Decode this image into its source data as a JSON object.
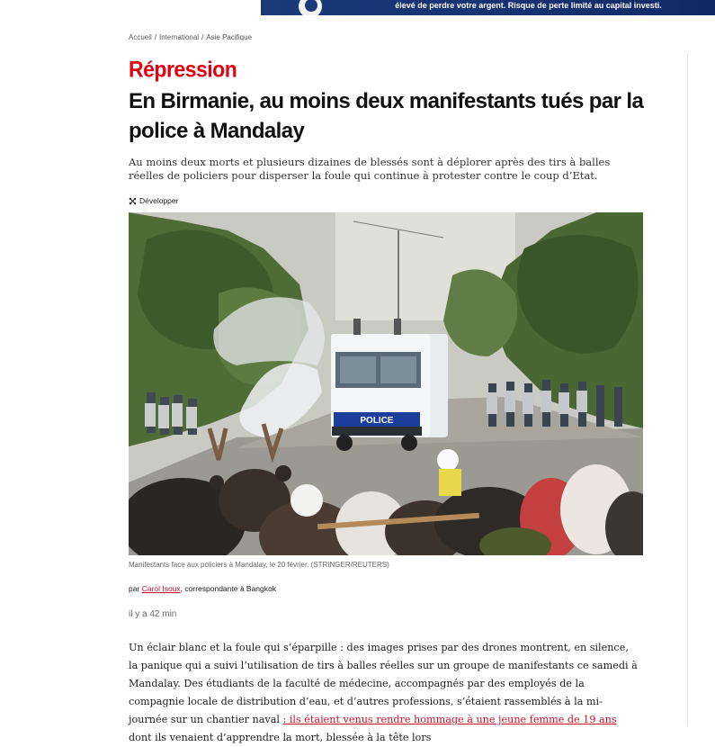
{
  "ad": {
    "text": "élevé de perdre votre argent. Risque de perte limité au capital investi."
  },
  "breadcrumb": [
    "Accueil",
    "International",
    "Asie Pacifique"
  ],
  "article": {
    "kicker": "Répression",
    "headline": "En Birmanie, au moins deux manifestants tués par la police à Mandalay",
    "lede": "Au moins deux morts et plusieurs dizaines de blessés sont à déplorer après des tirs à balles réelles de policiers pour disperser la foule qui continue à protester contre le coup d’Etat.",
    "expand_label": "Développer",
    "image": {
      "truck_label": "POLICE",
      "caption": "Manifestants face aux policiers à Mandalay, le 20 février. (STRINGER/REUTERS)"
    },
    "byline": {
      "prefix": "par",
      "author": "Carol Isoux",
      "role": ", correspondante à Bangkok"
    },
    "time": "il y a 42 min",
    "body": {
      "text_1": "Un éclair blanc et la foule qui s’éparpille : des images prises par des drones montrent, en silence, la panique qui a suivi l’utilisation de tirs à balles réelles sur un groupe de manifestants ce samedi à Mandalay. Des étudiants de la faculté de médecine, accompagnés par des employés de la compagnie locale de distribution d’eau, et d’autres professions, s’étaient rassemblés à la mi-journée sur un chantier naval ",
      "link": ": ils étaient venus rendre hommage à une jeune femme de 19 ans",
      "text_2": " dont ils venaient d’apprendre la mort, blessée à la tête lors"
    }
  }
}
